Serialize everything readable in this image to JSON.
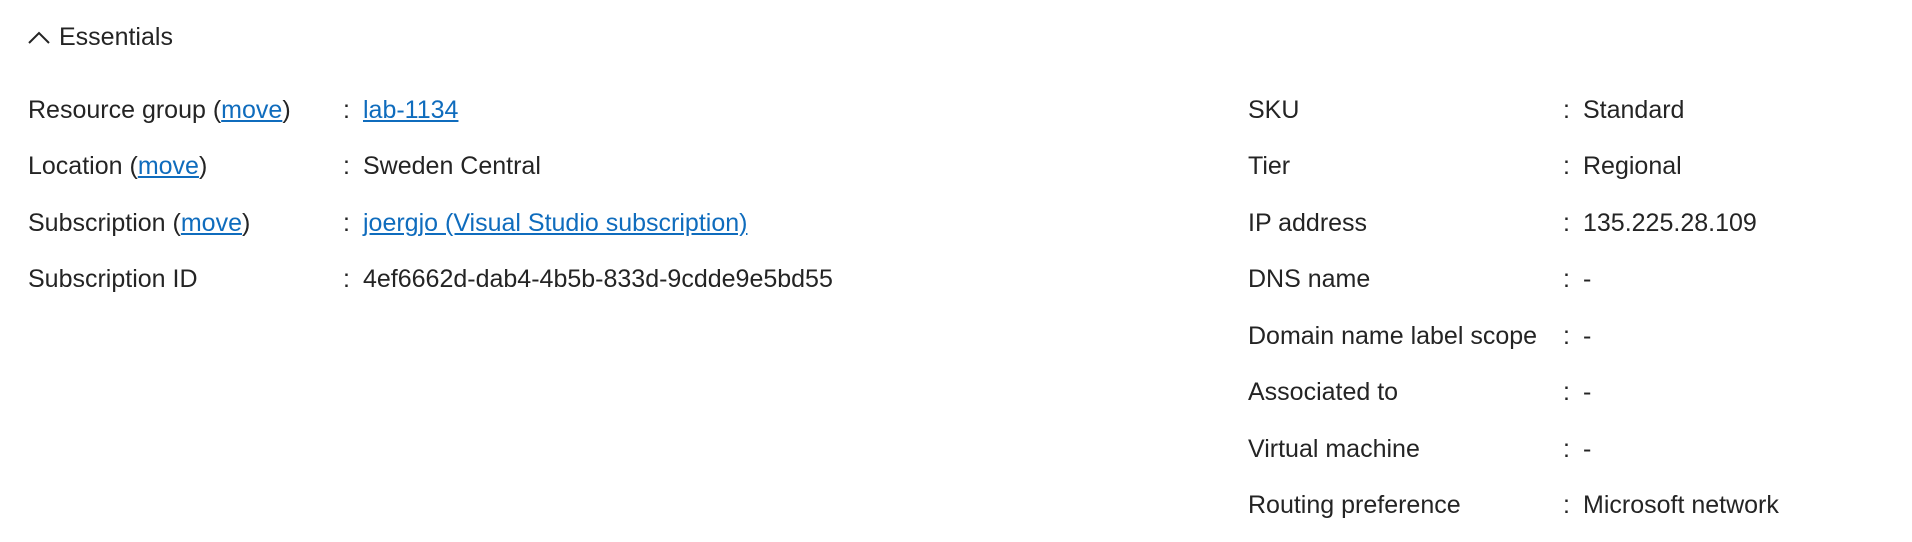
{
  "essentials": {
    "title": "Essentials",
    "toggle_icon": "chevron-up-icon"
  },
  "left": {
    "resource_group": {
      "label": "Resource group",
      "move_link": "move",
      "value": "lab-1134"
    },
    "location": {
      "label": "Location",
      "move_link": "move",
      "value": "Sweden Central"
    },
    "subscription": {
      "label": "Subscription",
      "move_link": "move",
      "value": "joergjo (Visual Studio subscription)"
    },
    "subscription_id": {
      "label": "Subscription ID",
      "value": "4ef6662d-dab4-4b5b-833d-9cdde9e5bd55"
    }
  },
  "right": {
    "sku": {
      "label": "SKU",
      "value": "Standard"
    },
    "tier": {
      "label": "Tier",
      "value": "Regional"
    },
    "ip_address": {
      "label": "IP address",
      "value": "135.225.28.109"
    },
    "dns_name": {
      "label": "DNS name",
      "value": "-"
    },
    "domain_name_label_scope": {
      "label": "Domain name label scope",
      "value": "-"
    },
    "associated_to": {
      "label": "Associated to",
      "value": "-"
    },
    "virtual_machine": {
      "label": "Virtual machine",
      "value": "-"
    },
    "routing_preference": {
      "label": "Routing preference",
      "value": "Microsoft network"
    }
  },
  "separator": ":",
  "colors": {
    "link": "#0f6cbd",
    "text": "#242424",
    "background": "#ffffff"
  }
}
